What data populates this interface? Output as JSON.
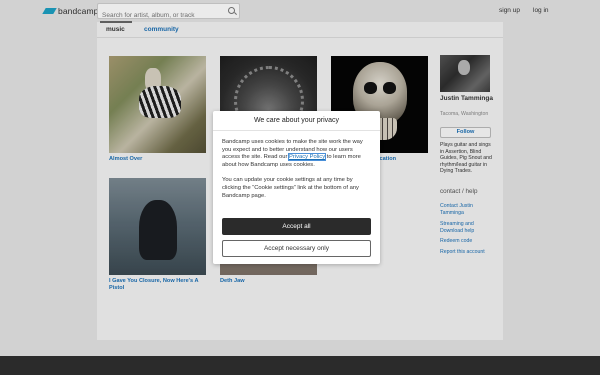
{
  "header": {
    "logo_text": "bandcamp",
    "search_placeholder": "Search for artist, album, or track",
    "signup_label": "sign up",
    "login_label": "log in"
  },
  "tabs": {
    "music": "music",
    "community": "community"
  },
  "albums": [
    {
      "title": "Almost Over"
    },
    {
      "title": ""
    },
    {
      "title": "ication"
    },
    {
      "title": "I Gave You Closure, Now Here's A Pistol"
    },
    {
      "title": "Deth Jaw"
    }
  ],
  "profile": {
    "name": "Justin Tamminga",
    "location": "Tacoma, Washington",
    "follow_label": "Follow",
    "bio": "Plays guitar and sings in Assertion, Blind Guides, Pig Snout and rhythm/lead guitar in Dying Trades.",
    "contact_heading": "contact / help",
    "links": [
      "Contact Justin Tamminga",
      "Streaming and Download help",
      "Redeem code",
      "Report this account"
    ]
  },
  "cookie_modal": {
    "title": "We care about your privacy",
    "para1_before": "Bandcamp uses cookies to make the site work the way you expect and to better understand how our users access the site. Read our ",
    "privacy_link": "Privacy Policy",
    "para1_after": " to learn more about how Bandcamp uses cookies.",
    "para2": "You can update your cookie settings at any time by clicking the “Cookie settings” link at the bottom of any Bandcamp page.",
    "accept_all": "Accept all",
    "accept_necessary": "Accept necessary only"
  },
  "colors": {
    "accent": "#1a6fb5",
    "brand": "#1da0c3",
    "footer": "#2f2f2f",
    "primary_button": "#2b2b2b"
  },
  "icons": {
    "search": "search-icon"
  }
}
